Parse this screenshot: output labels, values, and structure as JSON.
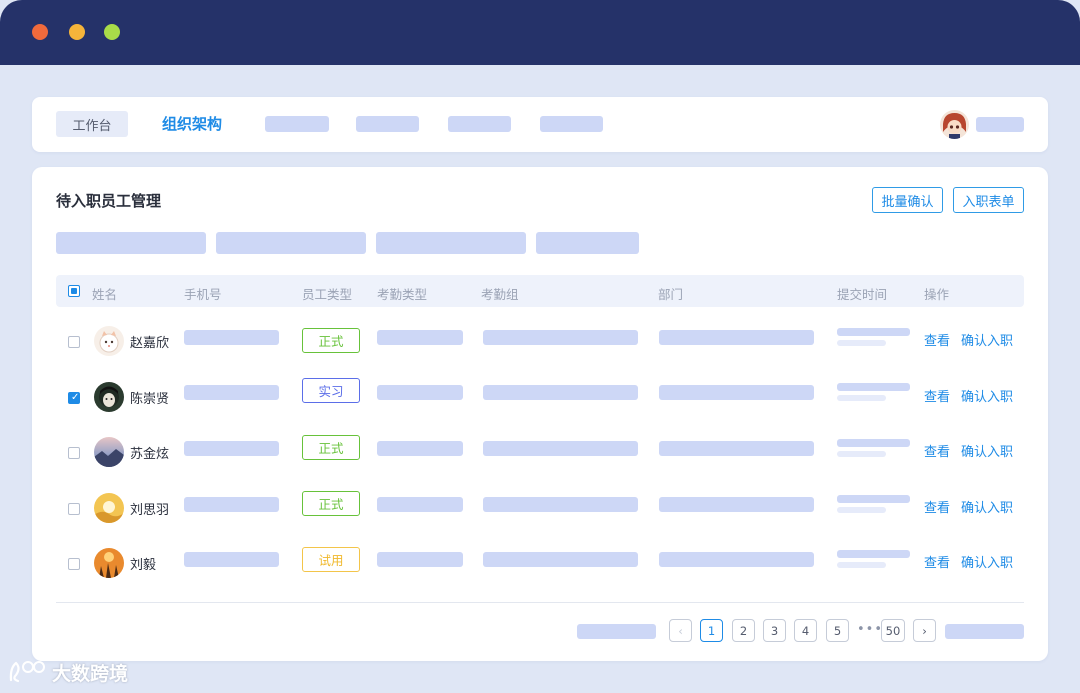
{
  "window": {
    "controls": [
      "close",
      "minimize",
      "maximize"
    ],
    "control_colors": {
      "close": "#f06a3c",
      "minimize": "#f5b43a",
      "maximize": "#a9dc49"
    }
  },
  "nav": {
    "tabs": [
      {
        "label": "工作台",
        "active": false
      },
      {
        "label": "组织架构",
        "active": true
      }
    ],
    "accent": "#1e8be6"
  },
  "panel": {
    "title": "待入职员工管理",
    "batch_confirm_label": "批量确认",
    "onboard_form_label": "入职表单",
    "table": {
      "headers": [
        "姓名",
        "手机号",
        "员工类型",
        "考勤类型",
        "考勤组",
        "部门",
        "提交时间",
        "操作"
      ],
      "rows": [
        {
          "name": "赵嘉欣",
          "type": "正式",
          "type_color": "#67c23a",
          "checked": false
        },
        {
          "name": "陈崇贤",
          "type": "实习",
          "type_color": "#5b6ee8",
          "checked": true
        },
        {
          "name": "苏金炫",
          "type": "正式",
          "type_color": "#67c23a",
          "checked": false
        },
        {
          "name": "刘思羽",
          "type": "正式",
          "type_color": "#67c23a",
          "checked": false
        },
        {
          "name": "刘毅",
          "type": "试用",
          "type_color": "#f3c54a",
          "checked": false
        }
      ],
      "action_view": "查看",
      "action_confirm": "确认入职"
    },
    "pagination": {
      "pages": [
        "1",
        "2",
        "3",
        "4",
        "5"
      ],
      "ellipsis": "•••",
      "last_page": "50",
      "current": "1"
    }
  },
  "watermark": {
    "text": "大数跨境"
  }
}
